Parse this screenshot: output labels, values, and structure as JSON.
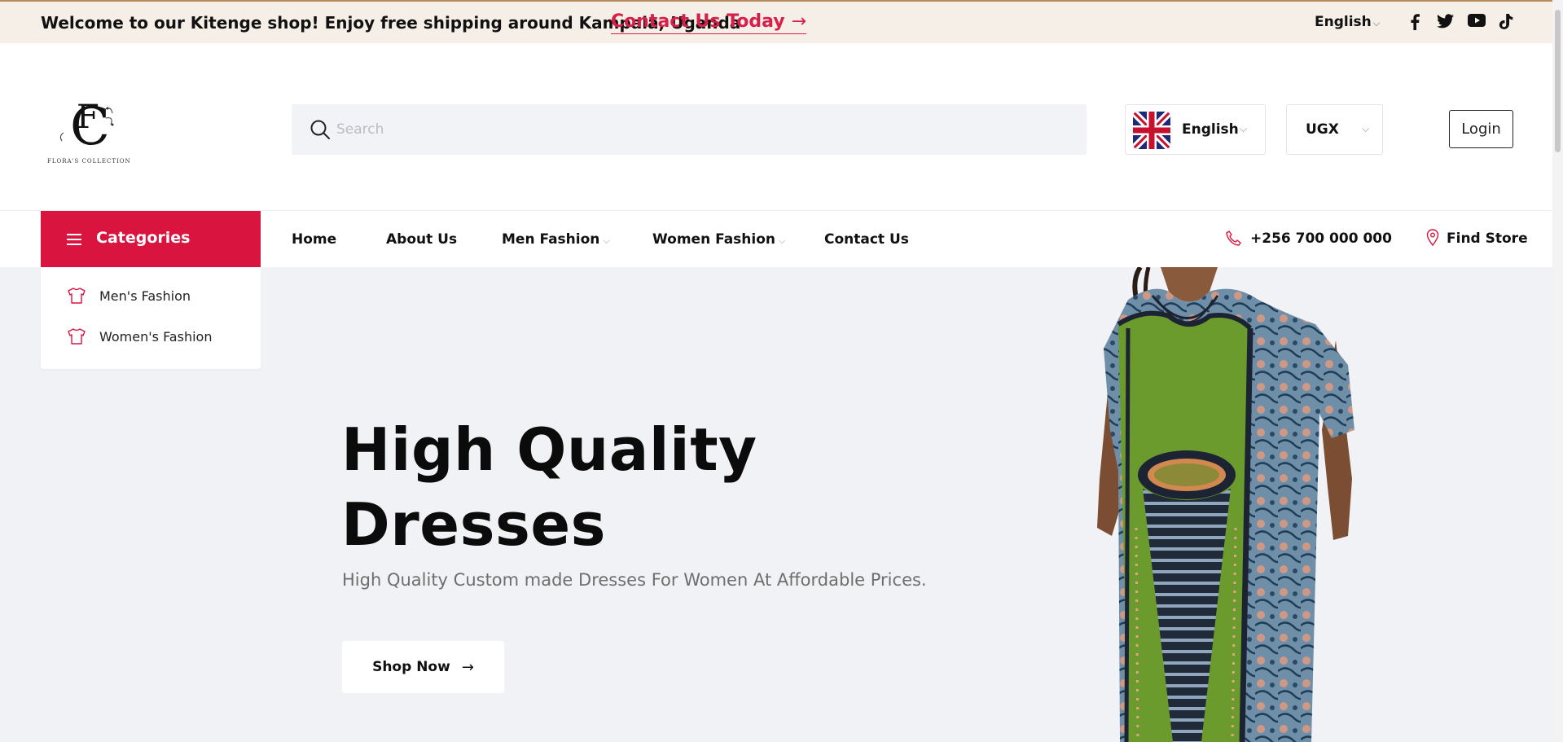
{
  "topbar": {
    "welcome": "Welcome to our Kitenge shop! Enjoy free shipping around Kampala, Uganda",
    "contact_link": "Contact Us Today",
    "contact_arrow": "→",
    "language": "English",
    "social_icons": [
      "facebook-icon",
      "twitter-icon",
      "youtube-icon",
      "tiktok-icon"
    ]
  },
  "header": {
    "logo_text": "FLORA'S COLLECTION",
    "search": {
      "placeholder": "Search",
      "value": ""
    },
    "language": {
      "label": "English",
      "flag": "uk-flag-icon"
    },
    "currency": {
      "label": "UGX"
    },
    "login_label": "Login"
  },
  "nav": {
    "categories_label": "Categories",
    "items": [
      {
        "label": "Home",
        "has_dropdown": false
      },
      {
        "label": "About Us",
        "has_dropdown": false
      },
      {
        "label": "Men Fashion",
        "has_dropdown": true
      },
      {
        "label": "Women Fashion",
        "has_dropdown": true
      },
      {
        "label": "Contact Us",
        "has_dropdown": false
      }
    ],
    "phone": "+256 700 000 000",
    "find_store": "Find Store"
  },
  "categories_menu": {
    "items": [
      {
        "label": "Men's Fashion",
        "icon": "shirt-icon"
      },
      {
        "label": "Women's Fashion",
        "icon": "shirt-icon"
      }
    ]
  },
  "hero": {
    "title_line1": "High Quality",
    "title_line2": "Dresses",
    "subtitle": "High Quality Custom made Dresses For Women At Affordable Prices.",
    "button_label": "Shop Now",
    "button_arrow": "→"
  },
  "colors": {
    "accent": "#d9143f",
    "topbar_bg": "#f5efe8",
    "hero_bg": "#f1f2f6",
    "text_dark": "#111111"
  }
}
